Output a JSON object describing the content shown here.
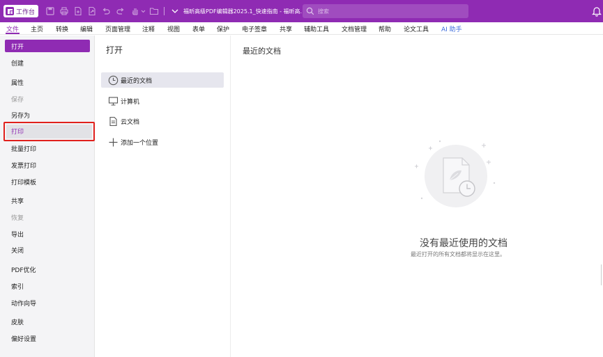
{
  "titlebar": {
    "workbench_label": "工作台",
    "window_title": "福昕高级PDF编辑器2025.1_快速指南 - 福昕高...",
    "search_placeholder": "搜索",
    "quick_access_icons": [
      "save-icon",
      "print-icon",
      "new-document-icon",
      "export-icon",
      "undo-icon",
      "redo-icon",
      "hand-tool-icon",
      "open-folder-icon"
    ]
  },
  "ribbon": {
    "tabs": [
      "文件",
      "主页",
      "转换",
      "编辑",
      "页面管理",
      "注释",
      "视图",
      "表单",
      "保护",
      "电子签章",
      "共享",
      "辅助工具",
      "文档管理",
      "帮助",
      "论文工具",
      "AI 助手"
    ],
    "active_tab": "文件"
  },
  "sidebar": {
    "items": [
      "打开",
      "创建",
      "属性",
      "保存",
      "另存为",
      "打印",
      "批量打印",
      "发票打印",
      "打印模板",
      "共享",
      "恢复",
      "导出",
      "关闭",
      "PDF优化",
      "索引",
      "动作向导",
      "皮肤",
      "偏好设置"
    ],
    "selected": "打开",
    "highlighted": "打印",
    "disabled": [
      "保存",
      "恢复"
    ]
  },
  "open_pane": {
    "title": "打开",
    "locations": [
      {
        "label": "最近的文档",
        "icon": "clock-icon"
      },
      {
        "label": "计算机",
        "icon": "computer-icon"
      },
      {
        "label": "云文档",
        "icon": "cloud-document-icon"
      },
      {
        "label": "添加一个位置",
        "icon": "plus-icon"
      }
    ],
    "selected_location": "最近的文档"
  },
  "recent": {
    "title": "最近的文档",
    "empty_title": "没有最近使用的文档",
    "empty_subtitle": "最近打开的所有文档都将显示在这里。"
  },
  "colors": {
    "brand": "#8f2bb3",
    "highlight_border": "#e0201c",
    "ai_tab": "#3b6bdc",
    "sidebar_bg": "#f4f4f6"
  }
}
